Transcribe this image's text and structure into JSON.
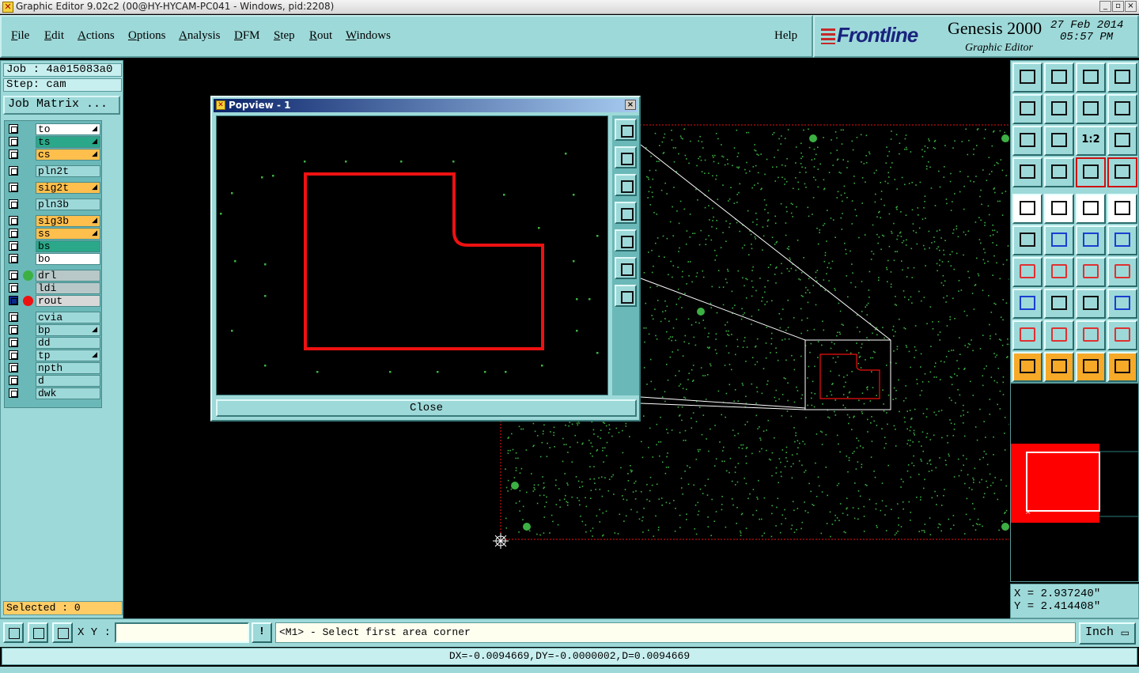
{
  "window": {
    "title": "Graphic Editor 9.02c2 (00@HY-HYCAM-PC041 - Windows, pid:2208)",
    "app_icon": "x-app-icon",
    "controls": [
      "_",
      "▫",
      "×"
    ]
  },
  "menu": {
    "items": [
      {
        "label": "File",
        "ul": "F",
        "rest": "ile"
      },
      {
        "label": "Edit",
        "ul": "E",
        "rest": "dit"
      },
      {
        "label": "Actions",
        "ul": "A",
        "rest": "ctions"
      },
      {
        "label": "Options",
        "ul": "O",
        "rest": "ptions"
      },
      {
        "label": "Analysis",
        "ul": "A",
        "rest": "nalysis"
      },
      {
        "label": "DFM",
        "ul": "D",
        "rest": "FM"
      },
      {
        "label": "Step",
        "ul": "S",
        "rest": "tep"
      },
      {
        "label": "Rout",
        "ul": "R",
        "rest": "out"
      },
      {
        "label": "Windows",
        "ul": "W",
        "rest": "indows"
      }
    ],
    "help": "Help"
  },
  "brand": {
    "logo": "Frontline",
    "product": "Genesis 2000",
    "subtitle": "Graphic Editor",
    "date": "27 Feb 2014",
    "time": "05:57 PM"
  },
  "left_panel": {
    "job": "Job : 4a015083a0",
    "step": "Step: cam",
    "job_matrix": "Job Matrix ...",
    "layers": [
      {
        "name": "to",
        "bg": "#ffffff",
        "mark": true
      },
      {
        "name": "ts",
        "bg": "#2aa889",
        "mark": true
      },
      {
        "name": "cs",
        "bg": "#ffbf4d",
        "mark": true
      },
      {
        "name": "pln2t",
        "bg": "#9ed9d9",
        "mark": false
      },
      {
        "name": "sig2t",
        "bg": "#ffbf4d",
        "mark": true
      },
      {
        "name": "pln3b",
        "bg": "#9ed9d9",
        "mark": false
      },
      {
        "name": "sig3b",
        "bg": "#ffbf4d",
        "mark": true
      },
      {
        "name": "ss",
        "bg": "#ffbf4d",
        "mark": true
      },
      {
        "name": "bs",
        "bg": "#2aa889",
        "mark": false
      },
      {
        "name": "bo",
        "bg": "#ffffff",
        "mark": false
      },
      {
        "name": "drl",
        "bg": "#b8c8c8",
        "mark": false,
        "dot": "#3cb043"
      },
      {
        "name": "ldi",
        "bg": "#b8c8c8",
        "mark": false
      },
      {
        "name": "rout",
        "bg": "#d8d8d8",
        "mark": false,
        "dot": "#ee1111",
        "active": true
      },
      {
        "name": "cvia",
        "bg": "#9ed9d9",
        "mark": false
      },
      {
        "name": "bp",
        "bg": "#9ed9d9",
        "mark": true
      },
      {
        "name": "dd",
        "bg": "#9ed9d9",
        "mark": false
      },
      {
        "name": "tp",
        "bg": "#9ed9d9",
        "mark": true
      },
      {
        "name": "npth",
        "bg": "#9ed9d9",
        "mark": false
      },
      {
        "name": "d",
        "bg": "#9ed9d9",
        "mark": false
      },
      {
        "name": "dwk",
        "bg": "#9ed9d9",
        "mark": false
      }
    ],
    "selected": "Selected : 0"
  },
  "popview": {
    "title": "Popview - 1",
    "close_label": "Close",
    "tools": [
      "zoom-window-icon",
      "zoom-in-icon",
      "zoom-out-icon",
      "pan-left-icon",
      "pan-right-icon",
      "fit-icon",
      "center-icon"
    ]
  },
  "right_toolbar": {
    "buttons": [
      "zoom-in-icon",
      "zoom-out-icon",
      "home-icon",
      "split-view-icon",
      "pan-left-icon",
      "pan-right-icon",
      "rotate-icon",
      "snap-icon",
      "fit-all-icon",
      "center-icon",
      "scale-1-2-icon",
      "help-icon",
      "measure-icon",
      "grid-icon",
      "traffic-light-icon",
      "traffic-light-2-icon",
      "add-pad-icon",
      "add-line-icon",
      "ruler-icon",
      "circle-icon",
      "connect-icon",
      "move-icon",
      "copy-icon",
      "resize-icon",
      "angle-icon",
      "slash-icon",
      "arc-icon",
      "flip-icon",
      "pad-edit-icon",
      "line-edit-icon",
      "measure-box-icon",
      "polygon-icon",
      "triangle-icon",
      "triangle-2-icon",
      "arch-icon",
      "arch-2-icon",
      "select-arrow-icon",
      "select-box-icon",
      "select-contour-icon",
      "select-path-icon"
    ],
    "scale_label": "1:2"
  },
  "coordinates": {
    "x": "X = 2.937240\"",
    "y": "Y = 2.414408\""
  },
  "bottom": {
    "xy_label": "X Y :",
    "xy_value": "",
    "excl": "!",
    "prompt": "<M1> - Select first area corner",
    "unit": "Inch",
    "status": "DX=-0.0094669,DY=-0.0000002,D=0.0094669"
  },
  "colors": {
    "panel": "#9ed9d9",
    "rout": "#ee1111",
    "pads": "#3cb043",
    "selected_bg": "#ffcc66"
  }
}
